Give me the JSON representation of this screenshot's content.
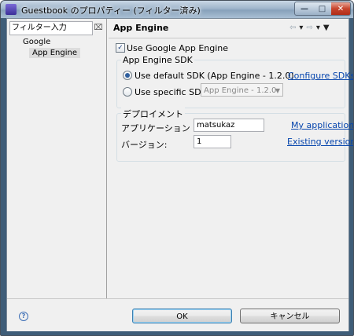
{
  "window": {
    "title": "Guestbook のプロパティー (フィルター済み)",
    "controls": {
      "minimize": "—",
      "maximize": "□",
      "close": "✕"
    }
  },
  "sidebar": {
    "filter_value": "フィルター入力",
    "tree": [
      {
        "label": "Google",
        "selected": false
      },
      {
        "label": "App Engine",
        "selected": true
      }
    ]
  },
  "page": {
    "title": "App Engine",
    "use_google_app_engine": {
      "label": "Use Google App Engine",
      "checked": true
    },
    "sdk_group": {
      "title": "App Engine SDK",
      "default_option": {
        "label": "Use default SDK (App Engine - 1.2.0)",
        "selected": true
      },
      "configure_link": "Configure SDKs...",
      "specific_option": {
        "label": "Use specific SDK:",
        "selected": false
      },
      "specific_select_value": "App Engine - 1.2.0"
    },
    "deploy_group": {
      "title": "デプロイメント",
      "app_id_label": "アプリケーション ID:",
      "app_id_value": "matsukaz",
      "my_apps_link": "My applications...",
      "version_label": "バージョン:",
      "version_value": "1",
      "existing_versions_link": "Existing versions..."
    }
  },
  "footer": {
    "ok_label": "OK",
    "cancel_label": "キャンセル"
  },
  "icons": {
    "title": "eclipse-icon",
    "clear_filter": "clear-filter-icon",
    "help": "help-icon",
    "nav_back": "back-arrow-icon",
    "nav_forward": "forward-arrow-icon",
    "view_menu": "view-menu-icon"
  }
}
